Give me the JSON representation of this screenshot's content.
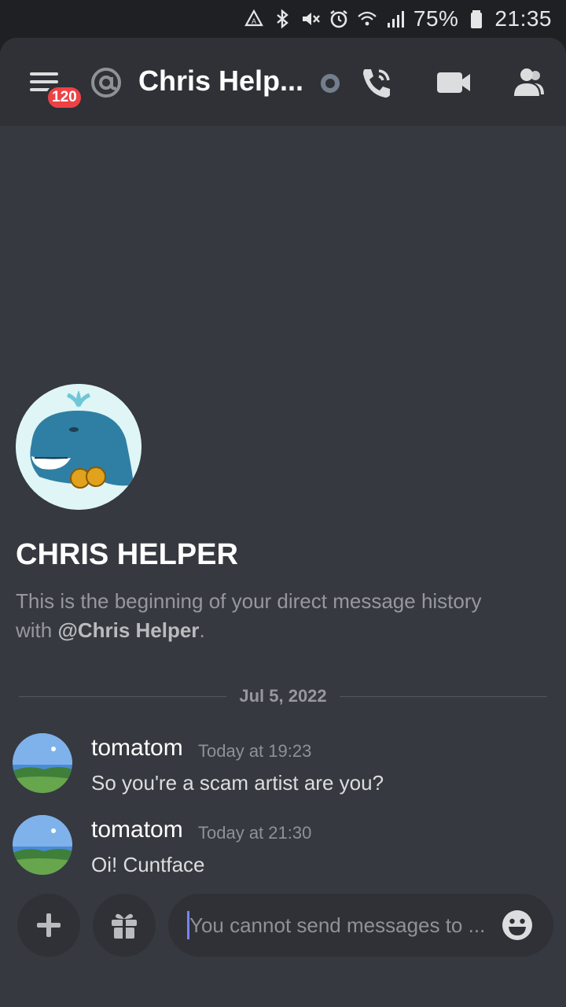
{
  "status_bar": {
    "icons": [
      "nfc-icon",
      "bluetooth-icon",
      "mute-icon",
      "alarm-icon",
      "wifi-icon",
      "signal-icon"
    ],
    "battery_percent": "75%",
    "time": "21:35"
  },
  "header": {
    "menu_badge": "120",
    "channel_name": "Chris Help...",
    "icons": [
      "menu-icon",
      "at-icon",
      "call-icon",
      "video-icon",
      "members-icon"
    ]
  },
  "intro": {
    "name": "CHRIS HELPER",
    "description_prefix": "This is the beginning of your direct message history with ",
    "mention": "@Chris Helper",
    "description_suffix": "."
  },
  "divider": {
    "date": "Jul 5, 2022"
  },
  "messages": [
    {
      "author": "tomatom",
      "timestamp": "Today at 19:23",
      "text": "So you're a scam artist are you?"
    },
    {
      "author": "tomatom",
      "timestamp": "Today at 21:30",
      "text": "Oi! Cuntface"
    }
  ],
  "composer": {
    "placeholder": "You cannot send messages to ..."
  },
  "colors": {
    "background": "#36393f",
    "header": "#2f3136",
    "badge": "#ed4245",
    "accent": "#7983f5"
  }
}
